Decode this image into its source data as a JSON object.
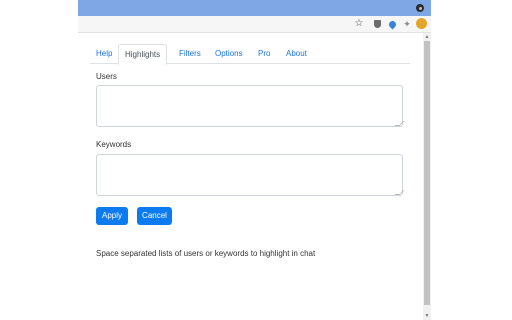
{
  "browser": {
    "toolbar_icons": [
      "star-icon",
      "shield-icon",
      "drop-icon",
      "puzzle-icon",
      "avatar-icon"
    ]
  },
  "tabs": [
    {
      "label": "Help"
    },
    {
      "label": "Highlights"
    },
    {
      "label": "Filters"
    },
    {
      "label": "Options"
    },
    {
      "label": "Pro"
    },
    {
      "label": "About"
    }
  ],
  "active_tab": "Highlights",
  "form": {
    "users_label": "Users",
    "users_value": "",
    "keywords_label": "Keywords",
    "keywords_value": "",
    "apply_label": "Apply",
    "cancel_label": "Cancel",
    "hint": "Space separated lists of users or keywords to highlight in chat"
  },
  "colors": {
    "titlebar": "#7fa6e5",
    "accent": "#0d7bf0",
    "tab_link": "#1a73e8"
  }
}
